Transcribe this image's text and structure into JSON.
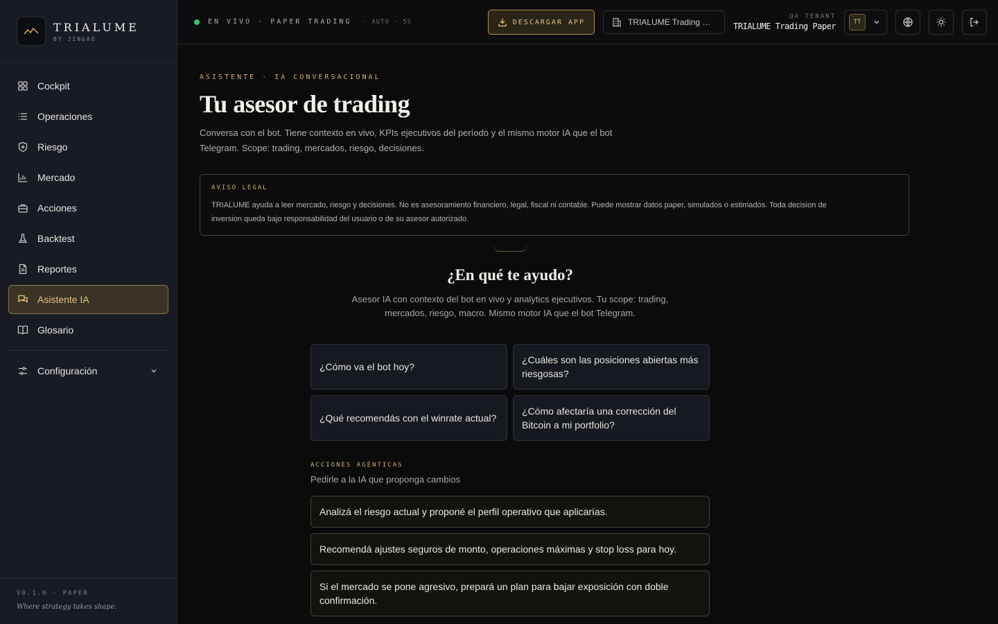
{
  "brand": {
    "name": "TRIALUME",
    "sub": "BY JINGAO"
  },
  "sidebar": {
    "items": [
      {
        "label": "Cockpit",
        "icon": "grid-icon"
      },
      {
        "label": "Operaciones",
        "icon": "list-icon"
      },
      {
        "label": "Riesgo",
        "icon": "shield-icon"
      },
      {
        "label": "Mercado",
        "icon": "bar-chart-icon"
      },
      {
        "label": "Acciones",
        "icon": "briefcase-icon"
      },
      {
        "label": "Backtest",
        "icon": "flask-icon"
      },
      {
        "label": "Reportes",
        "icon": "document-icon"
      },
      {
        "label": "Asistente IA",
        "icon": "chat-icon",
        "active": true
      },
      {
        "label": "Glosario",
        "icon": "book-icon"
      }
    ],
    "config_label": "Configuración",
    "version": "V0.1.0 · PAPER",
    "tagline": "Where strategy takes shape."
  },
  "topbar": {
    "live_text": "EN VIVO · PAPER TRADING",
    "auto_text": "· AUTO · 5S",
    "download_label": "DESCARGAR APP",
    "tenant_select": "TRIALUME Trading Pa…",
    "tenant_label": "QA TENANT",
    "tenant_value": "TRIALUME Trading Paper",
    "avatar_initials": "TT"
  },
  "page": {
    "eyebrow": "ASISTENTE · IA CONVERSACIONAL",
    "title": "Tu asesor de trading",
    "description": "Conversa con el bot. Tiene contexto en vivo, KPIs ejecutivos del período y el mismo motor IA que el bot Telegram. Scope: trading, mercados, riesgo, decisiones."
  },
  "legal": {
    "label": "AVISO LEGAL",
    "text": "TRIALUME ayuda a leer mercado, riesgo y decisiones. No es asesoramiento financiero, legal, fiscal ni contable. Puede mostrar datos paper, simulados o estimados. Toda decision de inversion queda bajo responsabilidad del usuario o de su asesor autorizado."
  },
  "help": {
    "title": "¿En qué te ayudo?",
    "description": "Asesor IA con contexto del bot en vivo y analytics ejecutivos. Tu scope: trading, mercados, riesgo, macro. Mismo motor IA que el bot Telegram."
  },
  "suggestions": [
    "¿Cómo va el bot hoy?",
    "¿Cuáles son las posiciones abiertas más riesgosas?",
    "¿Qué recomendás con el winrate actual?",
    "¿Cómo afectaría una corrección del Bitcoin a mi portfolio?"
  ],
  "agentic": {
    "label": "ACCIONES AGÉNTICAS",
    "sub": "Pedirle a la IA que proponga cambios",
    "items": [
      "Analizá el riesgo actual y proponé el perfil operativo que aplicarías.",
      "Recomendá ajustes seguros de monto, operaciones máximas y stop loss para hoy.",
      "Si el mercado se pone agresivo, prepará un plan para bajar exposición con doble confirmación."
    ]
  },
  "colors": {
    "accent": "#d4b16e",
    "live": "#35c46a",
    "background": "#0b0b0c",
    "sidebar": "#181b24"
  }
}
